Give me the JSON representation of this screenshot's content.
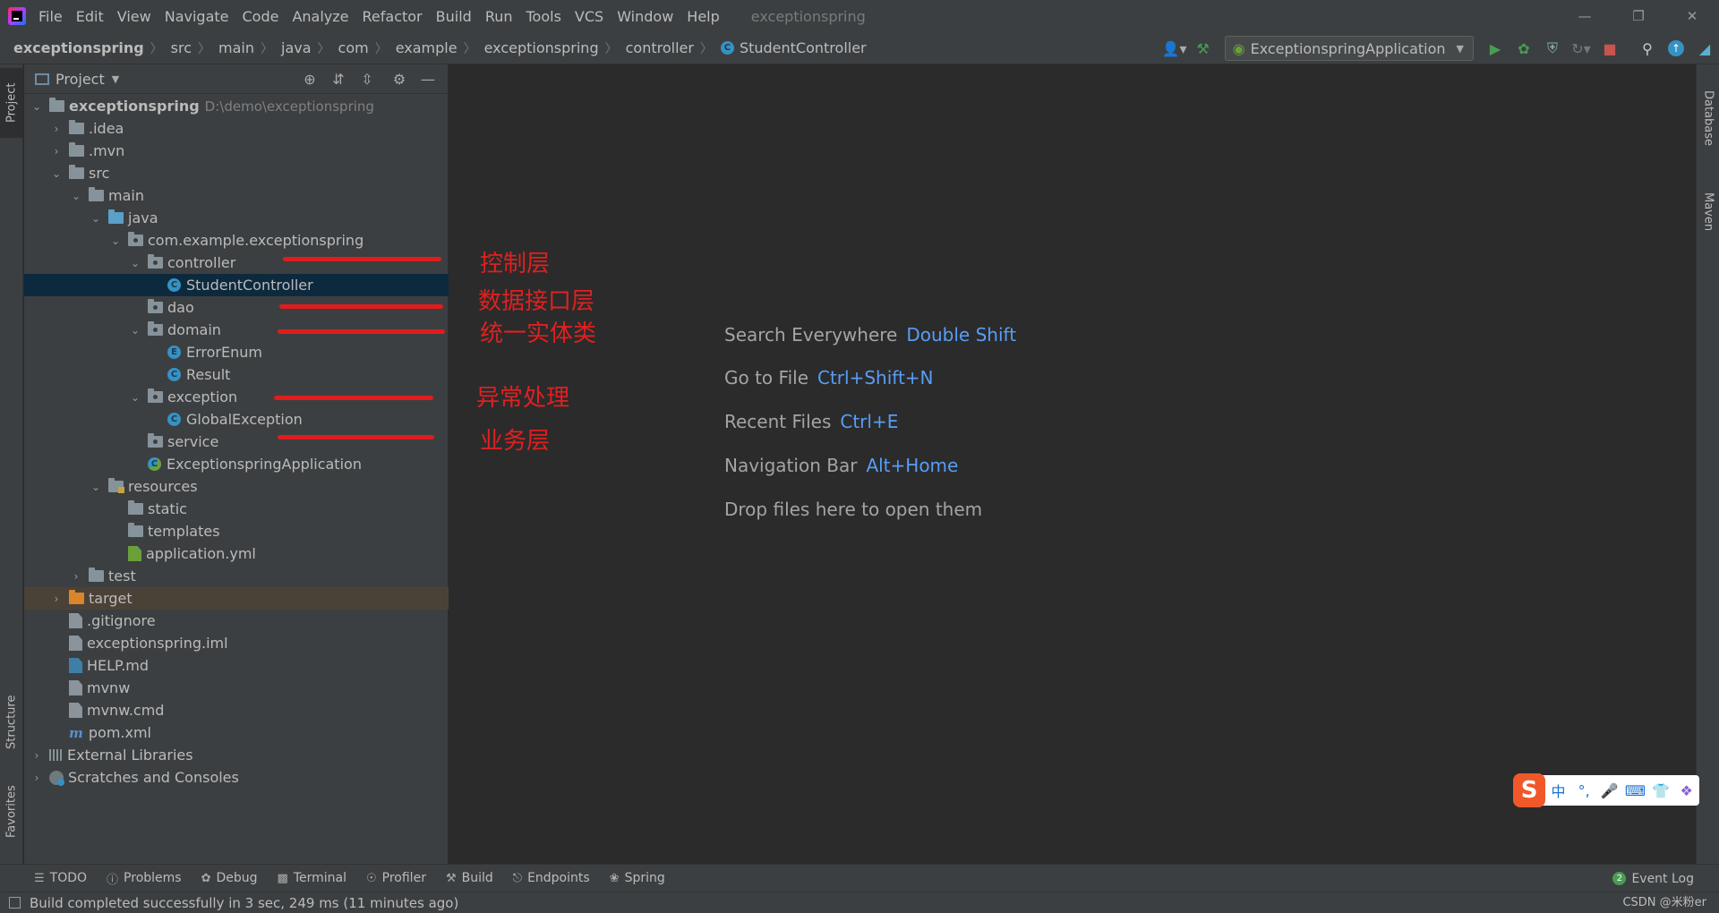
{
  "menubar": {
    "items": [
      "File",
      "Edit",
      "View",
      "Navigate",
      "Code",
      "Analyze",
      "Refactor",
      "Build",
      "Run",
      "Tools",
      "VCS",
      "Window",
      "Help"
    ],
    "window_title": "exceptionspring"
  },
  "breadcrumb": [
    "exceptionspring",
    "src",
    "main",
    "java",
    "com",
    "example",
    "exceptionspring",
    "controller",
    "StudentController"
  ],
  "run_config": "ExceptionspringApplication",
  "project_panel": {
    "title": "Project",
    "root": {
      "name": "exceptionspring",
      "path": "D:\\demo\\exceptionspring"
    },
    "items": [
      ".idea",
      ".mvn",
      "src",
      "main",
      "java",
      "com.example.exceptionspring",
      "controller",
      "StudentController",
      "dao",
      "domain",
      "ErrorEnum",
      "Result",
      "exception",
      "GlobalException",
      "service",
      "ExceptionspringApplication",
      "resources",
      "static",
      "templates",
      "application.yml",
      "test",
      "target",
      ".gitignore",
      "exceptionspring.iml",
      "HELP.md",
      "mvnw",
      "mvnw.cmd",
      "pom.xml",
      "External Libraries",
      "Scratches and Consoles"
    ]
  },
  "side_tabs": {
    "project": "Project",
    "structure": "Structure",
    "favorites": "Favorites",
    "database": "Database",
    "maven": "Maven"
  },
  "annotations": [
    "控制层",
    "数据接口层",
    "统一实体类",
    "异常处理",
    "业务层"
  ],
  "editor_hints": [
    {
      "label": "Search Everywhere",
      "key": "Double Shift"
    },
    {
      "label": "Go to File",
      "key": "Ctrl+Shift+N"
    },
    {
      "label": "Recent Files",
      "key": "Ctrl+E"
    },
    {
      "label": "Navigation Bar",
      "key": "Alt+Home"
    },
    {
      "label": "Drop files here to open them",
      "key": ""
    }
  ],
  "bottom_tabs": [
    "TODO",
    "Problems",
    "Debug",
    "Terminal",
    "Profiler",
    "Build",
    "Endpoints",
    "Spring"
  ],
  "event_log": {
    "label": "Event Log",
    "count": "2"
  },
  "status": "Build completed successfully in 3 sec, 249 ms (11 minutes ago)",
  "watermark": "CSDN @米粉er",
  "ime": {
    "logo": "S",
    "mode": "中"
  }
}
